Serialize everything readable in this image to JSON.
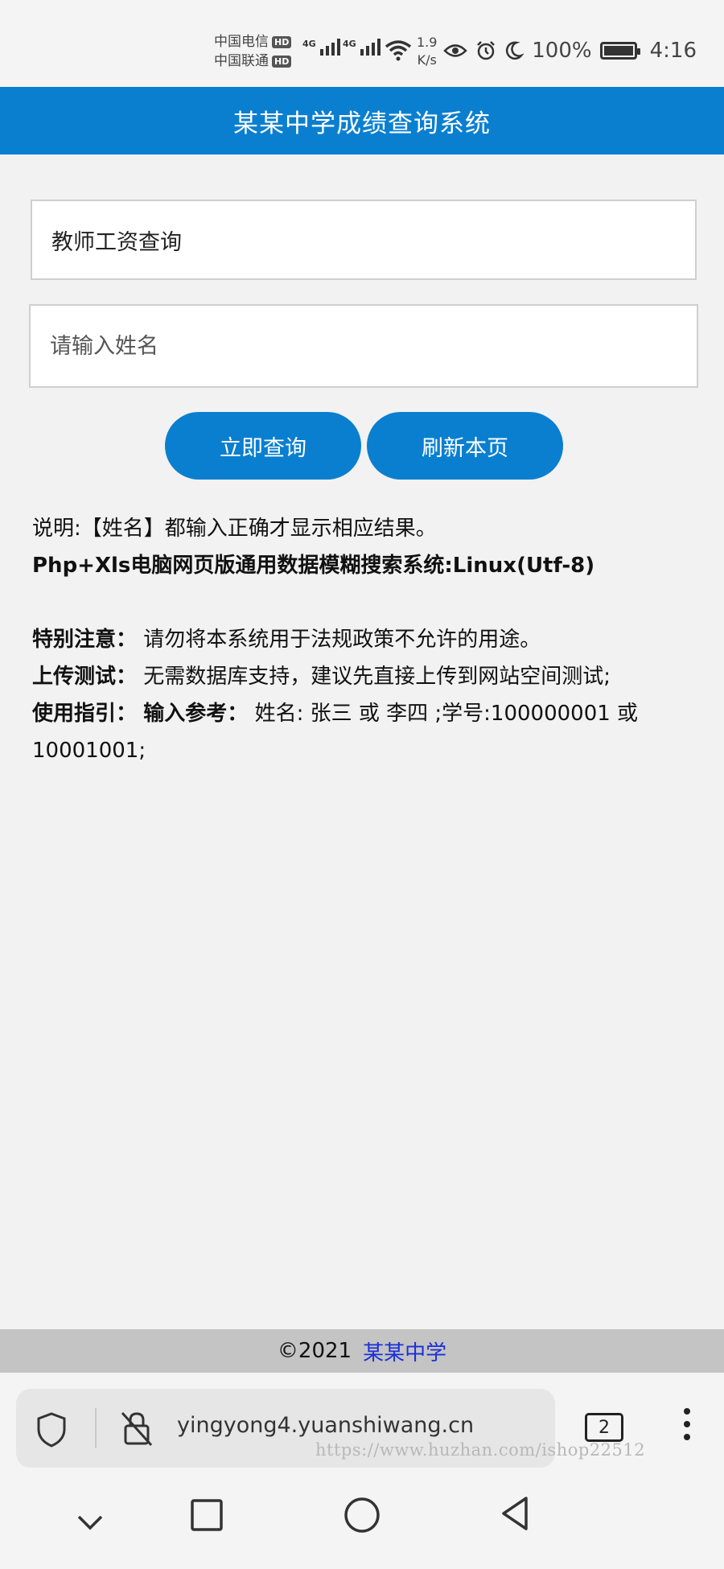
{
  "status_bar": {
    "carrier1": "中国电信",
    "carrier2": "中国联通",
    "hd_badge": "HD",
    "network1": "4G",
    "network2": "4G",
    "speed_value": "1.9",
    "speed_unit": "K/s",
    "battery": "100%",
    "time": "4:16",
    "icons": [
      "eye-icon",
      "alarm-icon",
      "moon-icon",
      "battery-icon"
    ]
  },
  "header": {
    "title": "某某中学成绩查询系统"
  },
  "form": {
    "select_value": "教师工资查询",
    "name_placeholder": "请输入姓名",
    "query_button": "立即查询",
    "refresh_button": "刷新本页"
  },
  "notes": {
    "line1": "说明:【姓名】都输入正确才显示相应结果。",
    "line2": "Php+Xls电脑网页版通用数据模糊搜索系统:Linux(Utf-8)",
    "notice_label": "特别注意：",
    "notice_text": "请勿将本系统用于法规政策不允许的用途。",
    "upload_label": "上传测试：",
    "upload_text": "无需数据库支持，建议先直接上传到网站空间测试;",
    "guide_label": "使用指引：",
    "guide_ref_label": "输入参考：",
    "guide_text": "姓名: 张三 或 李四 ;学号:100000001 或 10001001;"
  },
  "footer": {
    "copyright": "©2021",
    "link": "某某中学"
  },
  "browser": {
    "url": "yingyong4.yuanshiwang.cn",
    "tab_count": "2",
    "watermark": "https://www.huzhan.com/ishop22512"
  },
  "colors": {
    "accent": "#0a7fd0",
    "footer_bg": "#c4c4c4",
    "link": "#1a2fd8"
  }
}
